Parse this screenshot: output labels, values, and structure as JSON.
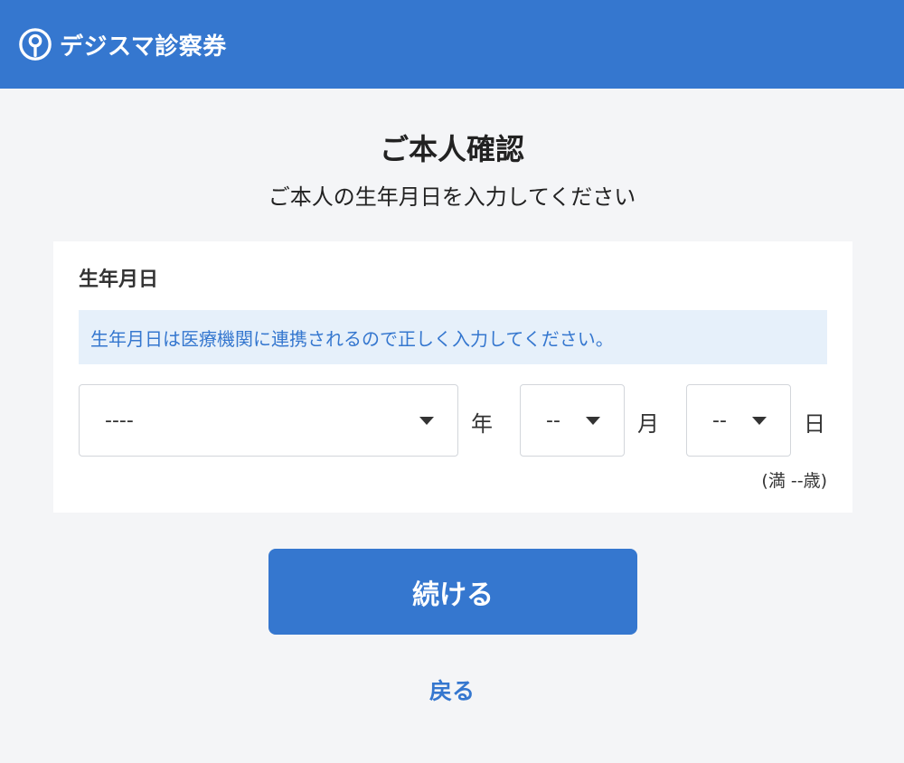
{
  "header": {
    "brand": "デジスマ診察券",
    "logo_icon": "location-pin-icon",
    "bg_color": "#3577cf"
  },
  "page": {
    "title": "ご本人確認",
    "subtitle": "ご本人の生年月日を入力してください"
  },
  "birthdate": {
    "label": "生年月日",
    "notice": "生年月日は医療機関に連携されるので正しく入力してください。",
    "year": {
      "value": "----",
      "unit": "年"
    },
    "month": {
      "value": "--",
      "unit": "月"
    },
    "day": {
      "value": "--",
      "unit": "日"
    },
    "age_text": "(満 --歳)"
  },
  "actions": {
    "continue_label": "続ける",
    "back_label": "戻る"
  }
}
